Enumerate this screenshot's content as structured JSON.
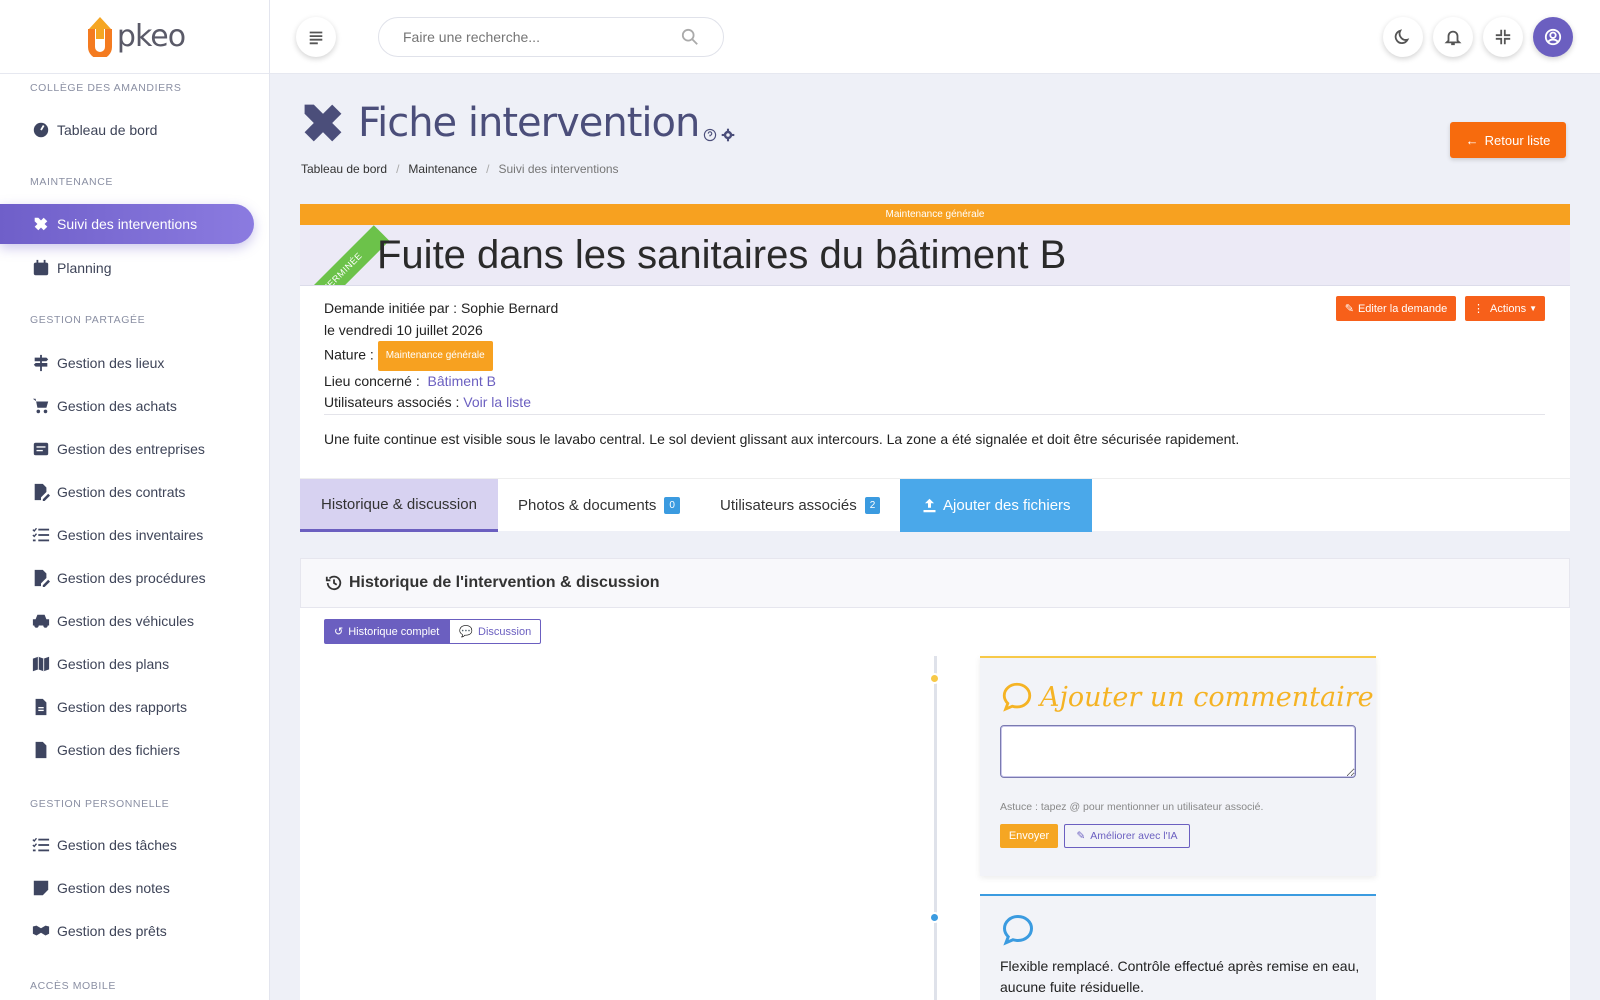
{
  "app": {
    "logo_text": "pkeo"
  },
  "sidebar": {
    "sections": [
      {
        "title": "Collège des Amandiers"
      },
      {
        "title": "Maintenance"
      },
      {
        "title": "Gestion partagée"
      },
      {
        "title": "Gestion personnelle"
      },
      {
        "title": "Accès mobile"
      }
    ],
    "items": [
      {
        "label": "Tableau de bord",
        "icon": "gauge-icon"
      },
      {
        "label": "Suivi des interventions",
        "icon": "tools-icon"
      },
      {
        "label": "Planning",
        "icon": "calendar-icon"
      },
      {
        "label": "Gestion des lieux",
        "icon": "signpost-icon"
      },
      {
        "label": "Gestion des achats",
        "icon": "cart-icon"
      },
      {
        "label": "Gestion des entreprises",
        "icon": "card-icon"
      },
      {
        "label": "Gestion des contrats",
        "icon": "doc-edit-icon"
      },
      {
        "label": "Gestion des inventaires",
        "icon": "list-check-icon"
      },
      {
        "label": "Gestion des procédures",
        "icon": "doc-edit-icon"
      },
      {
        "label": "Gestion des véhicules",
        "icon": "car-icon"
      },
      {
        "label": "Gestion des plans",
        "icon": "map-icon"
      },
      {
        "label": "Gestion des rapports",
        "icon": "report-icon"
      },
      {
        "label": "Gestion des fichiers",
        "icon": "file-icon"
      },
      {
        "label": "Gestion des tâches",
        "icon": "list-check-icon"
      },
      {
        "label": "Gestion des notes",
        "icon": "note-icon"
      },
      {
        "label": "Gestion des prêts",
        "icon": "handshake-icon"
      }
    ]
  },
  "topbar": {
    "search_placeholder": "Faire une recherche..."
  },
  "page": {
    "title": "Fiche intervention",
    "breadcrumb": [
      "Tableau de bord",
      "Maintenance",
      "Suivi des interventions"
    ],
    "back_button": "Retour liste"
  },
  "intervention": {
    "category": "Maintenance générale",
    "status": "TERMINÉE",
    "title": "Fuite dans les sanitaires du bâtiment B",
    "initiated_by_label": "Demande initiée par :",
    "initiated_by": "Sophie Bernard",
    "date": "le vendredi 10 juillet 2026",
    "nature_label": "Nature :",
    "nature": "Maintenance générale",
    "lieu_label": "Lieu concerné :",
    "lieu": "Bâtiment B",
    "users_label": "Utilisateurs associés :",
    "users_link": "Voir la liste",
    "edit_button": "Editer la demande",
    "actions_button": "Actions",
    "description": "Une fuite continue est visible sous le lavabo central. Le sol devient glissant aux intercours. La zone a été signalée et doit être sécurisée rapidement."
  },
  "tabs": [
    {
      "label": "Historique & discussion"
    },
    {
      "label": "Photos & documents",
      "count": "0"
    },
    {
      "label": "Utilisateurs associés",
      "count": "2"
    },
    {
      "label": "Ajouter des fichiers"
    }
  ],
  "history": {
    "header": "Historique de l'intervention & discussion",
    "seg_all": "Historique complet",
    "seg_discussion": "Discussion",
    "comment_title": "Ajouter un commentaire",
    "tip": "Astuce : tapez @ pour mentionner un utilisateur associé.",
    "send": "Envoyer",
    "improve": "Améliorer avec l'IA",
    "entry_text": "Flexible remplacé. Contrôle effectué après remise en eau, aucune fuite résiduelle."
  },
  "colors": {
    "accent": "#6b5fc0",
    "orange": "#f76b0d",
    "category": "#f7a120",
    "status": "#6cc24a",
    "info": "#3b9be0"
  }
}
